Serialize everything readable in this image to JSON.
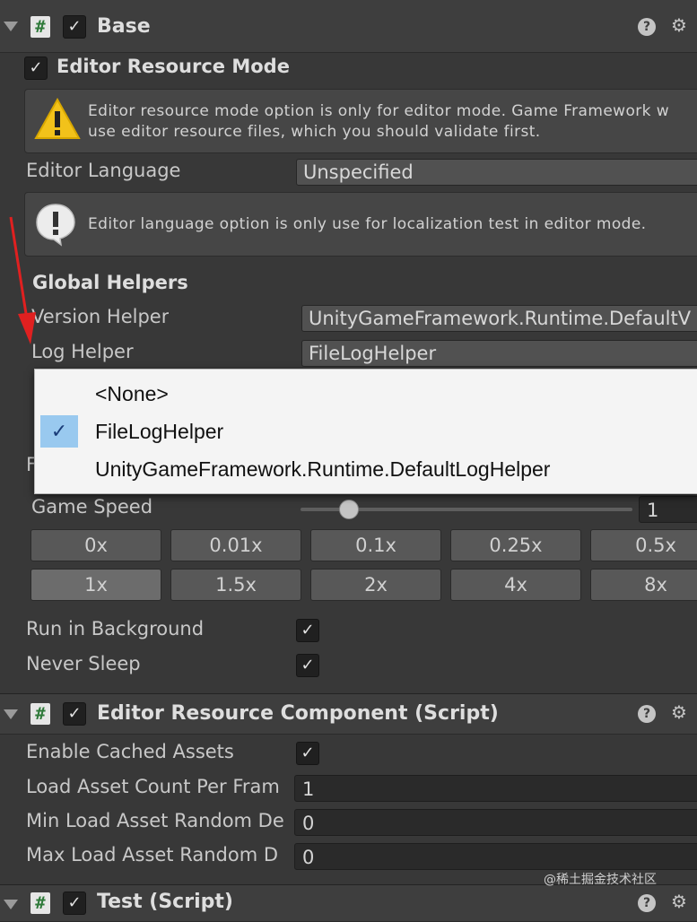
{
  "components": {
    "base": {
      "title": "Base",
      "editor_resource_mode": {
        "label": "Editor Resource Mode",
        "checked": true,
        "warning_line1": "Editor resource mode option is only for editor mode. Game Framework w",
        "warning_line2": "use editor resource files, which you should validate first."
      },
      "editor_language": {
        "label": "Editor Language",
        "value": "Unspecified",
        "info": "Editor language option is only use for localization test in editor mode."
      },
      "global_helpers": {
        "header": "Global Helpers",
        "version_helper_label": "Version Helper",
        "version_helper_value": "UnityGameFramework.Runtime.DefaultV",
        "log_helper_label": "Log Helper",
        "log_helper_value": "FileLogHelper"
      },
      "partial_labels": {
        "row_a": "F"
      },
      "game_speed": {
        "label": "Game Speed",
        "value": "1",
        "slider_fraction": 0.14
      },
      "speed_buttons_row1": [
        "0x",
        "0.01x",
        "0.1x",
        "0.25x",
        "0.5x"
      ],
      "speed_buttons_row2": [
        "1x",
        "1.5x",
        "2x",
        "4x",
        "8x"
      ],
      "active_speed": "1x",
      "run_in_background": {
        "label": "Run in Background",
        "checked": true
      },
      "never_sleep": {
        "label": "Never Sleep",
        "checked": true
      }
    },
    "editor_resource_component": {
      "title": "Editor Resource Component (Script)",
      "enable_cached_assets": {
        "label": "Enable Cached Assets",
        "checked": true
      },
      "load_asset_count": {
        "label": "Load Asset Count Per Fram",
        "value": "1"
      },
      "min_load_random": {
        "label": "Min Load Asset Random De",
        "value": "0"
      },
      "max_load_random": {
        "label": "Max Load Asset Random D",
        "value": "0"
      }
    },
    "test": {
      "title": "Test (Script)"
    }
  },
  "dropdown": {
    "options": [
      "<None>",
      "FileLogHelper",
      "UnityGameFramework.Runtime.DefaultLogHelper"
    ],
    "selected": "FileLogHelper"
  },
  "watermark": "@稀土掘金技术社区",
  "colors": {
    "panel_bg": "#383838",
    "header_bg": "#3e3e3e",
    "dropdown_bg": "#f4f4f4",
    "dropdown_selected": "#99c9ef",
    "annotation_arrow": "#e02020"
  },
  "icons": [
    "foldout-arrow-icon",
    "script-icon",
    "checkmark-icon",
    "warning-icon",
    "info-icon",
    "help-icon",
    "settings-sliders-icon"
  ]
}
